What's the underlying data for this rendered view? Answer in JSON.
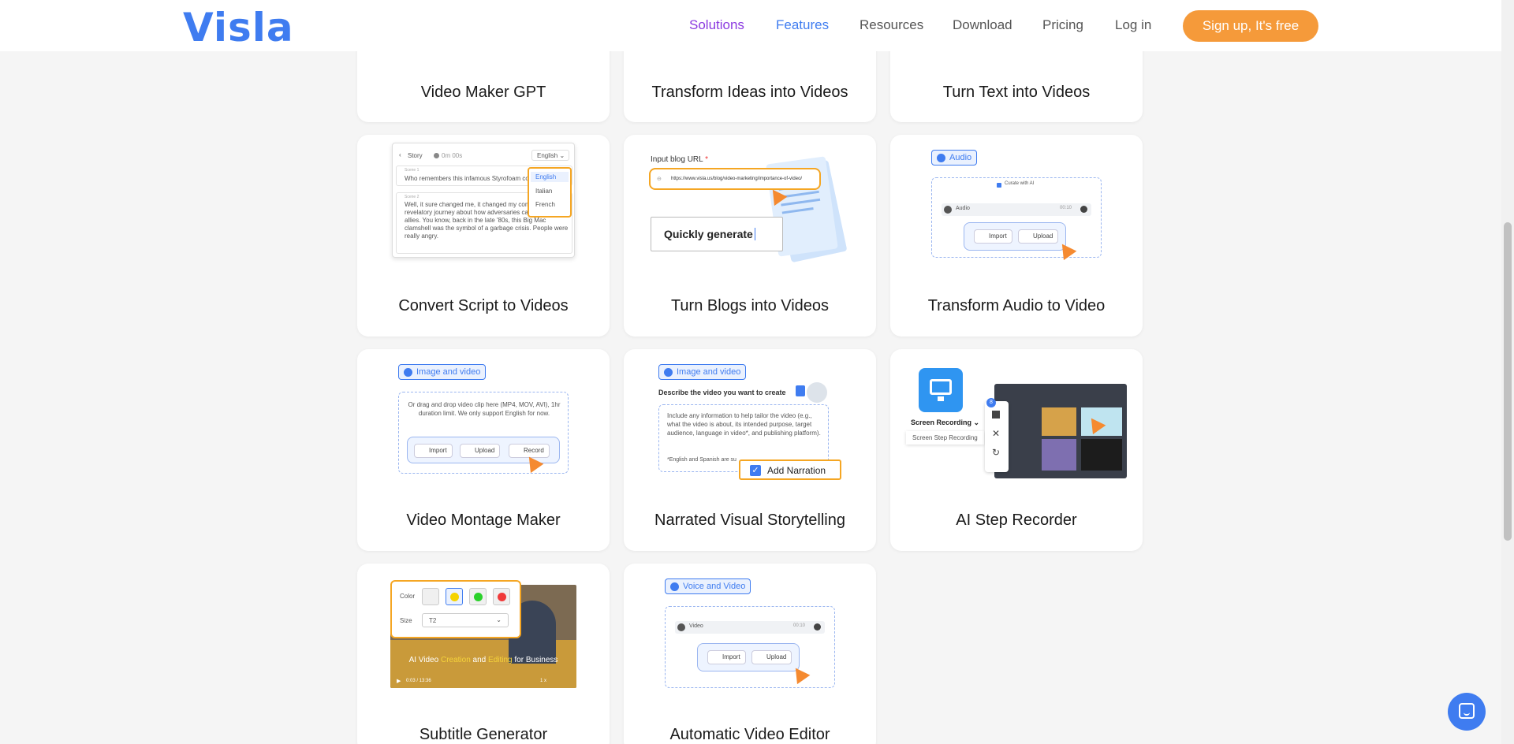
{
  "header": {
    "logo": "Visla",
    "nav": {
      "solutions": "Solutions",
      "features": "Features",
      "resources": "Resources",
      "download": "Download",
      "pricing": "Pricing",
      "login": "Log in"
    },
    "signup": "Sign up, It's free"
  },
  "cards": {
    "video_maker_gpt": "Video Maker GPT",
    "transform_ideas": "Transform Ideas into Videos",
    "turn_text": "Turn Text into Videos",
    "convert_script": "Convert Script to Videos",
    "turn_blogs": "Turn Blogs into Videos",
    "transform_audio": "Transform Audio to Video",
    "video_montage": "Video Montage Maker",
    "narrated_story": "Narrated Visual Storytelling",
    "ai_step_recorder": "AI Step Recorder",
    "subtitle_generator": "Subtitle Generator",
    "auto_video_editor": "Automatic Video Editor"
  },
  "illustrations": {
    "script": {
      "back_label": "Story",
      "duration": "0m 00s",
      "language_selected": "English",
      "languages": [
        "English",
        "Italian",
        "French"
      ],
      "scene1_label": "Scene 1",
      "scene1_text": "Who remembers this infamous Styrofoam conta",
      "scene2_label": "Scene 2",
      "scene2_text": "Well, it sure changed me, it changed my compa started a revelatory journey about how adversaries can be your best allies. You know, back in the late '80s, this Big Mac clamshell was the symbol of a garbage crisis. People were really angry."
    },
    "blog": {
      "label": "Input blog URL",
      "required": "*",
      "url": "https://www.visla.us/blog/video-marketing/importance-of-video/",
      "typing": "Quickly generate"
    },
    "audio": {
      "pill": "Audio",
      "curate": "Curate with AI",
      "track": "Audio",
      "time": "00:10",
      "import": "Import",
      "upload": "Upload"
    },
    "montage": {
      "pill": "Image and video",
      "hint": "Or drag and drop video clip here (MP4, MOV, AVI), 1hr duration limit. We only support English for now.",
      "import": "Import",
      "upload": "Upload",
      "record": "Record"
    },
    "narrated": {
      "pill": "Image and video",
      "heading": "Describe the video you want to create",
      "hint": "Include any information to help tailor the video (e.g., what the video is about, its intended purpose, target audience, language in video*, and publishing platform).",
      "note": "*English and Spanish are su",
      "checkbox_label": "Add Narration"
    },
    "recorder": {
      "option1": "Screen Recording",
      "option2": "Screen Step Recording",
      "badge": "8"
    },
    "subtitle": {
      "color_label": "Color",
      "size_label": "Size",
      "size_value": "T2",
      "caption_part1": "AI Video ",
      "caption_highlight1": "Creation",
      "caption_part2": " and ",
      "caption_highlight2": "Editing",
      "caption_part3": " for Business",
      "time": "0:03 / 13:36",
      "speed": "1 x"
    },
    "editor": {
      "pill": "Voice and Video",
      "track": "Video",
      "time": "00:10",
      "import": "Import",
      "upload": "Upload"
    }
  },
  "colors": {
    "brand_blue": "#3f7cf0",
    "accent_orange": "#f59a3a",
    "solutions_purple": "#8b3ae0"
  }
}
